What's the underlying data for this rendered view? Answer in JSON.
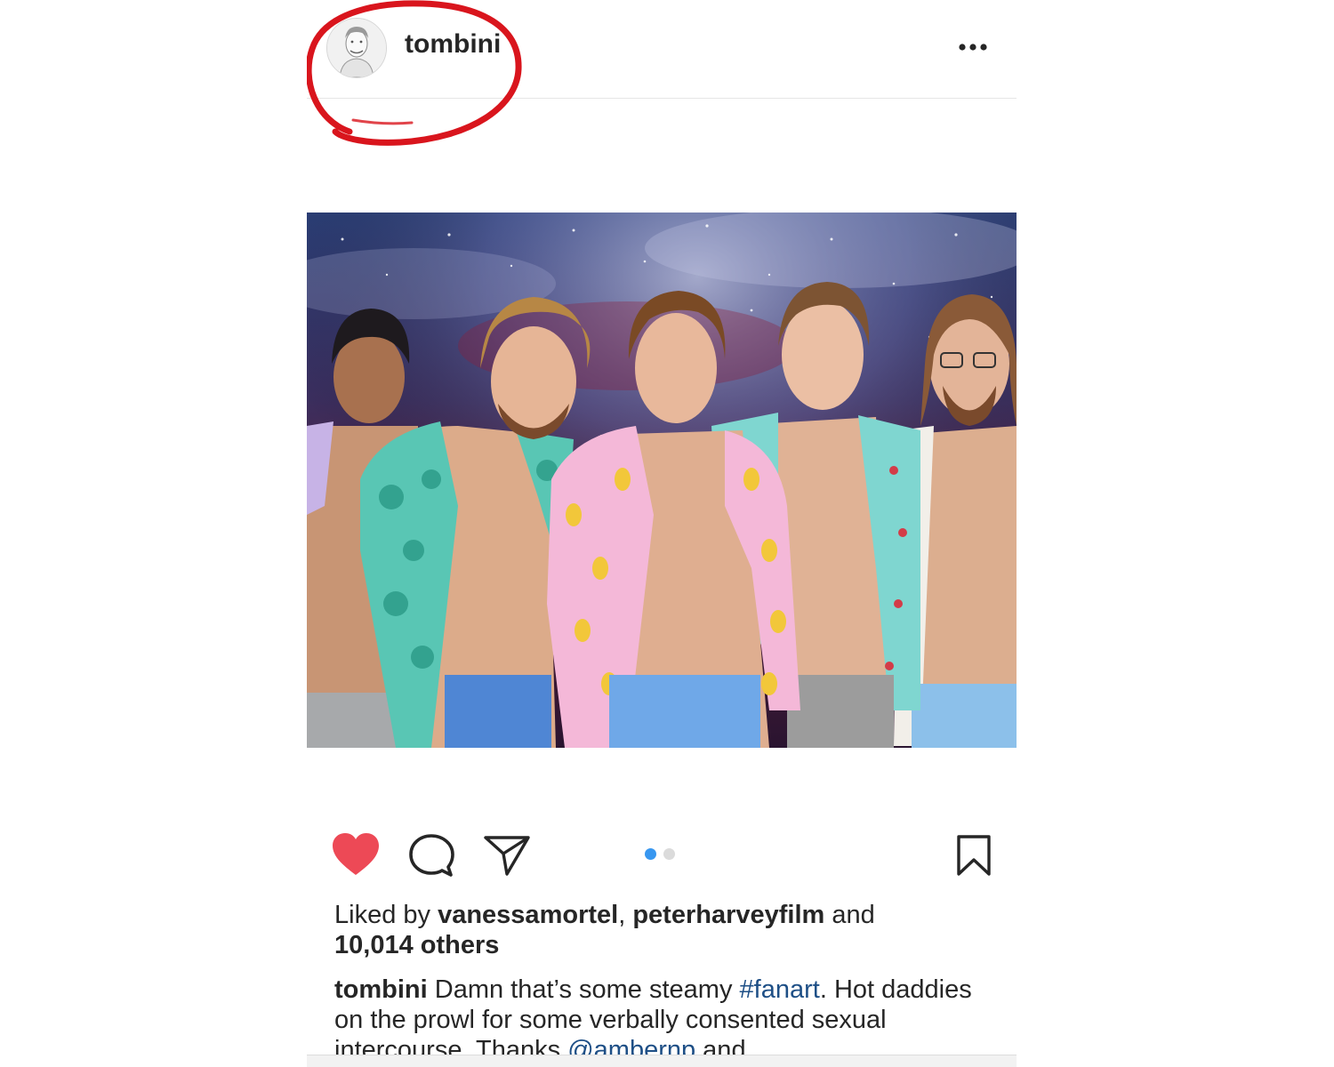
{
  "post": {
    "username": "tombini",
    "more_icon": "ellipsis-icon",
    "image_alt": "Painting of five men in open Hawaiian shirts against a starry galaxy sky",
    "carousel": {
      "count": 2,
      "active_index": 0
    },
    "icons": {
      "like": "heart-icon-filled",
      "comment": "comment-bubble-icon",
      "share": "paper-plane-icon",
      "save": "bookmark-icon"
    },
    "likes": {
      "prefix": "Liked by ",
      "user1": "vanessamortel",
      "separator": ", ",
      "user2": "peterharveyfilm",
      "and": " and",
      "others": "10,014 others"
    },
    "caption": {
      "username": "tombini",
      "text1": " Damn that’s some steamy ",
      "hashtag": "#fanart",
      "text2": ". Hot daddies on the prowl for some verbally consented sexual intercourse. Thanks ",
      "mention": "@ambernp",
      "text3": " and"
    }
  },
  "colors": {
    "heart": "#ed4956",
    "annotation": "#d9151d",
    "dot_active": "#3897f0",
    "dot_inactive": "#dbdbdb",
    "link": "#1e4f86"
  }
}
